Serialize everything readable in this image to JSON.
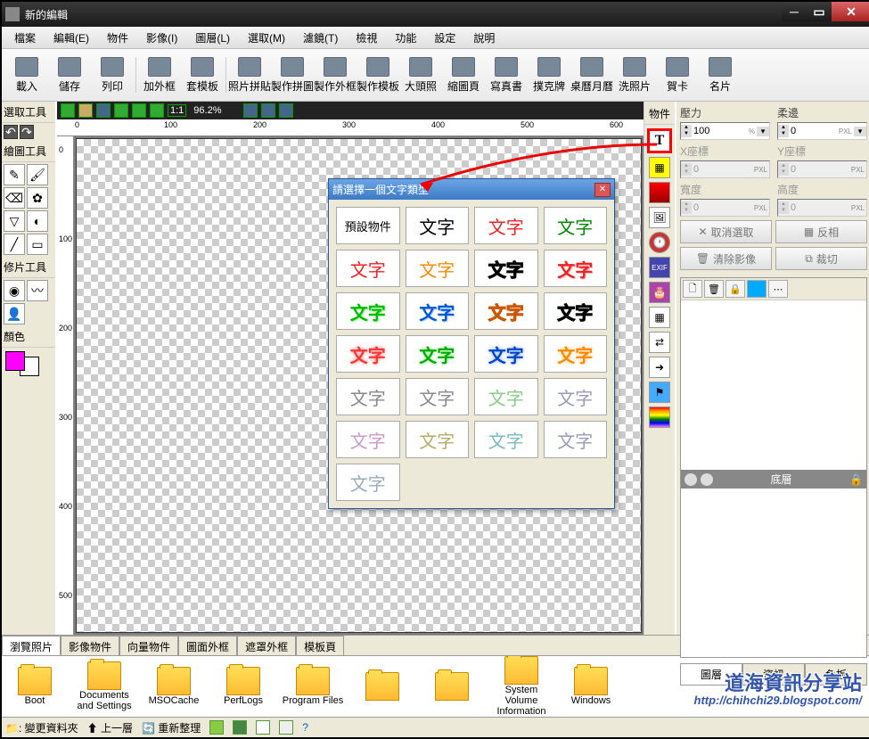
{
  "window": {
    "title": "新的編輯"
  },
  "menu": [
    "檔案",
    "編輯(E)",
    "物件",
    "影像(I)",
    "圖層(L)",
    "選取(M)",
    "濾鏡(T)",
    "檢視",
    "功能",
    "設定",
    "說明"
  ],
  "toolbar": [
    "載入",
    "儲存",
    "列印",
    "加外框",
    "套模板",
    "照片拼貼",
    "製作拼圖",
    "製作外框",
    "製作模板",
    "大頭照",
    "縮圖頁",
    "寫真書",
    "撲克牌",
    "桌曆月曆",
    "洗照片",
    "賀卡",
    "名片"
  ],
  "canvas": {
    "zoom": "96.2%",
    "ruler_h": [
      "0",
      "100",
      "200",
      "300",
      "400",
      "500",
      "600"
    ],
    "ruler_v": [
      "0",
      "100",
      "200",
      "300",
      "400",
      "500"
    ]
  },
  "left": {
    "sec1": "選取工具",
    "sec2": "繪圖工具",
    "sec3": "修片工具",
    "sec4": "顏色"
  },
  "rtlabel": "物件",
  "props": {
    "pressure": "壓力",
    "soft": "柔邊",
    "x": "X座標",
    "y": "Y座標",
    "w": "寬度",
    "h": "高度",
    "pressure_val": "100",
    "soft_val": "0",
    "x_val": "0",
    "y_val": "0",
    "w_val": "0",
    "h_val": "0",
    "unit": "PXL",
    "pct": "%",
    "deselect": "取消選取",
    "invert": "反相",
    "clear": "清除影像",
    "crop": "裁切"
  },
  "layers": {
    "name": "底層",
    "tabs": [
      "圖層",
      "資訊",
      "色板"
    ]
  },
  "btabs": [
    "瀏覽照片",
    "影像物件",
    "向量物件",
    "圖面外框",
    "遮罩外框",
    "模板頁"
  ],
  "folders": [
    "Boot",
    "Documents and Settings",
    "MSOCache",
    "PerfLogs",
    "Program Files",
    "",
    "",
    "System Volume Information",
    "Windows"
  ],
  "status": {
    "changeFolder": "變更資料夾",
    "up": "上一層",
    "refresh": "重新整理"
  },
  "dialog": {
    "title": "請選擇一個文字類型",
    "cells": [
      "預設物件",
      "文字",
      "文字",
      "文字",
      "文字",
      "文字",
      "文字",
      "文字",
      "文字",
      "文字",
      "文字",
      "文字",
      "文字",
      "文字",
      "文字",
      "文字",
      "文字",
      "文字",
      "文字",
      "文字",
      "文字",
      "文字",
      "文字",
      "文字",
      "文字"
    ],
    "styles": [
      "",
      "#000",
      "#f00",
      "#080",
      "#f00",
      "#f80",
      "#000 outline",
      "#f00 bold",
      "#0c0 bold",
      "#05f bold",
      "#f80 outline",
      "#000 outline2",
      "#f33 shadow",
      "#0a0 shadow",
      "#04c shadow",
      "#f80 shadow",
      "#888",
      "#888",
      "#8c8",
      "#99b",
      "#c9c",
      "#ba6",
      "#7bb",
      "#99b",
      "#9ab"
    ]
  },
  "watermark": {
    "line1": "道海資訊分享站",
    "line2": "http://chihchi29.blogspot.com/"
  }
}
